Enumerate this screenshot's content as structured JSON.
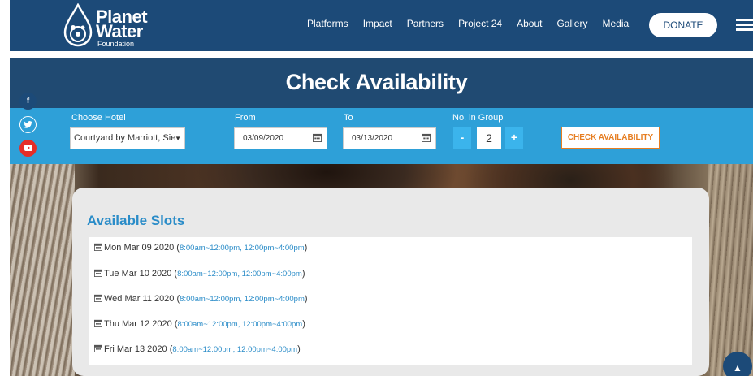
{
  "brand": {
    "line1": "Planet",
    "line2": "Water",
    "line3": "Foundation"
  },
  "nav": {
    "links": [
      "Platforms",
      "Impact",
      "Partners",
      "Project 24",
      "About",
      "Gallery",
      "Media"
    ],
    "donate": "DONATE"
  },
  "page": {
    "title": "Check Availability"
  },
  "form": {
    "hotel_label": "Choose Hotel",
    "hotel_value": "Courtyard by Marriott, Sie",
    "from_label": "From",
    "from_value": "03/09/2020",
    "to_label": "To",
    "to_value": "03/13/2020",
    "group_label": "No. in Group",
    "group_minus": "-",
    "group_value": "2",
    "group_plus": "+",
    "check_button": "CHECK AVAILABILITY"
  },
  "social": {
    "facebook": "f",
    "twitter": "t",
    "youtube": "▶"
  },
  "slots": {
    "title": "Available Slots",
    "items": [
      {
        "date": "Mon Mar 09 2020",
        "t1": "8:00am~12:00pm",
        "t2": "12:00pm~4:00pm"
      },
      {
        "date": "Tue Mar 10 2020",
        "t1": "8:00am~12:00pm",
        "t2": "12:00pm~4:00pm"
      },
      {
        "date": "Wed Mar 11 2020",
        "t1": "8:00am~12:00pm",
        "t2": "12:00pm~4:00pm"
      },
      {
        "date": "Thu Mar 12 2020",
        "t1": "8:00am~12:00pm",
        "t2": "12:00pm~4:00pm"
      },
      {
        "date": "Fri Mar 13 2020",
        "t1": "8:00am~12:00pm",
        "t2": "12:00pm~4:00pm"
      }
    ]
  },
  "colors": {
    "nav_bg": "#1c4a78",
    "title_bg": "#204a72",
    "form_bg": "#2ea0d8",
    "accent_orange": "#e67e22",
    "link_blue": "#2a8cc8"
  },
  "icons": {
    "hamburger": "menu-icon",
    "calendar": "calendar-icon",
    "scroll_top": "chevron-up-icon"
  }
}
